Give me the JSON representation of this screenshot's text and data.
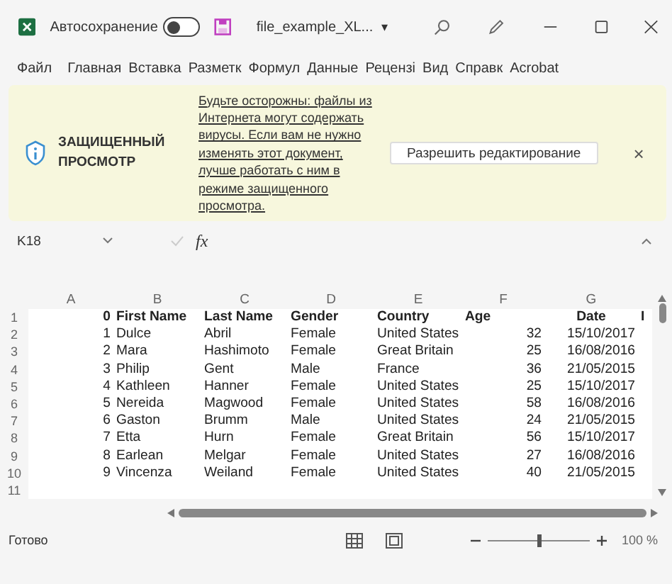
{
  "title_bar": {
    "autosave_label": "Автосохранение",
    "autosave_on": false,
    "file_name": "file_example_XL...",
    "dropdown_caret": "▾"
  },
  "ribbon_tabs": [
    "Файл",
    "Главная",
    "Вставка",
    "Разметк",
    "Формул",
    "Данные",
    "Рецензі",
    "Вид",
    "Справк",
    "Acrobat"
  ],
  "protected_view": {
    "title": "ЗАЩИЩЕННЫЙ ПРОСМОТР",
    "message": "Будьте осторожны: файлы из Интернета могут содержать вирусы. Если вам не нужно изменять этот документ, лучше работать с ним в режиме защищенного просмотра.",
    "button": "Разрешить редактирование",
    "close": "×"
  },
  "formula_bar": {
    "cell_ref": "K18",
    "fx": "fx"
  },
  "sheet": {
    "columns": [
      "A",
      "B",
      "C",
      "D",
      "E",
      "F",
      "G",
      ""
    ],
    "rows": [
      {
        "number": "1",
        "bold": true,
        "cells": [
          "0",
          "First Name",
          "Last Name",
          "Gender",
          "Country",
          "Age",
          "Date",
          "I"
        ]
      },
      {
        "number": "2",
        "bold": false,
        "cells": [
          "1",
          "Dulce",
          "Abril",
          "Female",
          "United States",
          "32",
          "15/10/2017",
          ""
        ]
      },
      {
        "number": "3",
        "bold": false,
        "cells": [
          "2",
          "Mara",
          "Hashimoto",
          "Female",
          "Great Britain",
          "25",
          "16/08/2016",
          ""
        ]
      },
      {
        "number": "4",
        "bold": false,
        "cells": [
          "3",
          "Philip",
          "Gent",
          "Male",
          "France",
          "36",
          "21/05/2015",
          ""
        ]
      },
      {
        "number": "5",
        "bold": false,
        "cells": [
          "4",
          "Kathleen",
          "Hanner",
          "Female",
          "United States",
          "25",
          "15/10/2017",
          ""
        ]
      },
      {
        "number": "6",
        "bold": false,
        "cells": [
          "5",
          "Nereida",
          "Magwood",
          "Female",
          "United States",
          "58",
          "16/08/2016",
          ""
        ]
      },
      {
        "number": "7",
        "bold": false,
        "cells": [
          "6",
          "Gaston",
          "Brumm",
          "Male",
          "United States",
          "24",
          "21/05/2015",
          ""
        ]
      },
      {
        "number": "8",
        "bold": false,
        "cells": [
          "7",
          "Etta",
          "Hurn",
          "Female",
          "Great Britain",
          "56",
          "15/10/2017",
          ""
        ]
      },
      {
        "number": "9",
        "bold": false,
        "cells": [
          "8",
          "Earlean",
          "Melgar",
          "Female",
          "United States",
          "27",
          "16/08/2016",
          ""
        ]
      },
      {
        "number": "10",
        "bold": false,
        "cells": [
          "9",
          "Vincenza",
          "Weiland",
          "Female",
          "United States",
          "40",
          "21/05/2015",
          ""
        ]
      },
      {
        "number": "11",
        "cells": [
          "",
          "",
          "",
          "",
          "",
          "",
          "",
          ""
        ]
      }
    ]
  },
  "status_bar": {
    "status": "Готово",
    "level": 0.5,
    "zoom": "100 %"
  }
}
